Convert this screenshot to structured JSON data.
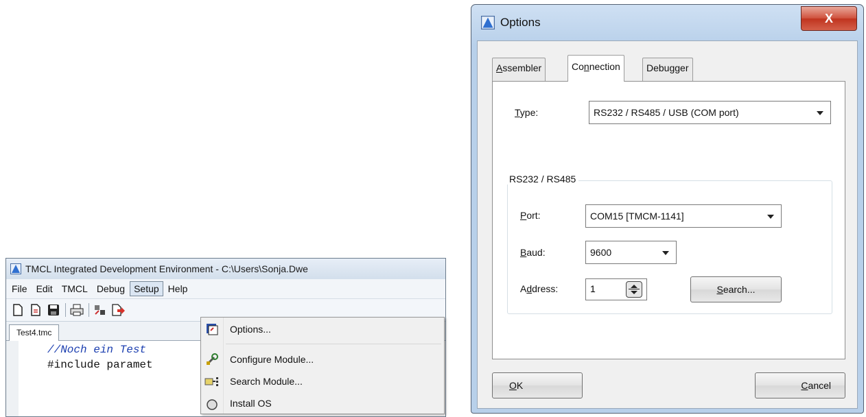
{
  "ide": {
    "title": "TMCL Integrated Development Environment - C:\\Users\\Sonja.Dwe",
    "menu": [
      {
        "label": "File"
      },
      {
        "label": "Edit"
      },
      {
        "label": "TMCL"
      },
      {
        "label": "Debug"
      },
      {
        "label": "Setup",
        "active": true
      },
      {
        "label": "Help"
      }
    ],
    "tab_label": "Test4.tmc",
    "code_line_1": "//Noch ein Test",
    "code_line_2": "#include paramet"
  },
  "setup_menu": {
    "items": [
      {
        "label": "Options...",
        "icon": "options-icon"
      },
      {
        "label": "Configure Module...",
        "icon": "configure-module-icon"
      },
      {
        "label": "Search Module...",
        "icon": "search-module-icon"
      },
      {
        "label": "Install OS",
        "icon": "install-os-icon"
      }
    ]
  },
  "dialog": {
    "title": "Options",
    "close_label": "X",
    "tabs": [
      {
        "pre": "",
        "acc": "A",
        "post": "ssembler"
      },
      {
        "pre": "Co",
        "acc": "n",
        "post": "nection",
        "selected": true
      },
      {
        "pre": "",
        "acc": "",
        "post": "Debugger"
      }
    ],
    "type_label": {
      "pre": "",
      "acc": "T",
      "post": "ype:"
    },
    "type_value": "RS232 / RS485 / USB (COM port)",
    "group_label": "RS232 / RS485",
    "port_label": {
      "pre": "",
      "acc": "P",
      "post": "ort:"
    },
    "port_value": "COM15  [TMCM-1141]",
    "baud_label": {
      "pre": "",
      "acc": "B",
      "post": "aud:"
    },
    "baud_value": "9600",
    "address_label": {
      "pre": "A",
      "acc": "d",
      "post": "dress:"
    },
    "address_value": "1",
    "search_button": {
      "pre": "",
      "acc": "S",
      "post": "earch..."
    },
    "ok_button": {
      "pre": "",
      "acc": "O",
      "post": "K"
    },
    "cancel_button": {
      "pre": "",
      "acc": "C",
      "post": "ancel"
    }
  }
}
